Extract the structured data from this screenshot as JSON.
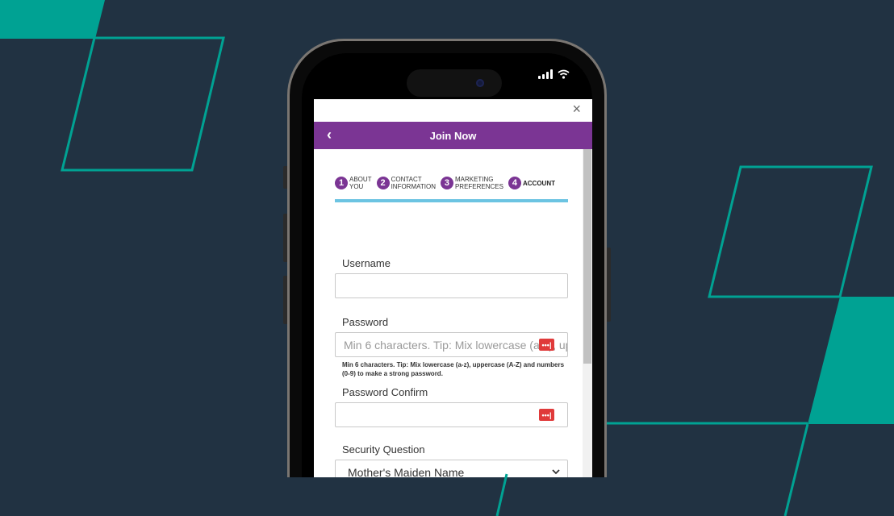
{
  "app": {
    "header_title": "Join Now",
    "close_glyph": "×",
    "back_glyph": "‹"
  },
  "steps": [
    {
      "num": "1",
      "label_line1": "ABOUT",
      "label_line2": "YOU"
    },
    {
      "num": "2",
      "label_line1": "CONTACT",
      "label_line2": "INFORMATION"
    },
    {
      "num": "3",
      "label_line1": "MARKETING",
      "label_line2": "PREFERENCES"
    },
    {
      "num": "4",
      "label_line1": "ACCOUNT",
      "label_line2": ""
    }
  ],
  "form": {
    "username_label": "Username",
    "username_value": "",
    "password_label": "Password",
    "password_placeholder": "Min 6 characters. Tip: Mix lowercase (a-z), uppercase (A-Z) and numbers (0-9) to make a strong password.",
    "password_hint": "Min 6 characters. Tip: Mix lowercase (a-z), uppercase (A-Z) and numbers (0-9) to make a strong password.",
    "password_confirm_label": "Password Confirm",
    "security_question_label": "Security Question",
    "security_question_value": "Mother's Maiden Name",
    "password_manager_glyph": "•••|"
  },
  "colors": {
    "background": "#213242",
    "accent_teal": "#00a293",
    "header_purple": "#7b3594",
    "progress_blue": "#6cc4e2",
    "password_icon_red": "#e03a3a"
  },
  "icons": {
    "status": [
      "signal-icon",
      "wifi-icon"
    ],
    "password_manager": "password-manager-icon",
    "select": "chevron-down-icon"
  }
}
